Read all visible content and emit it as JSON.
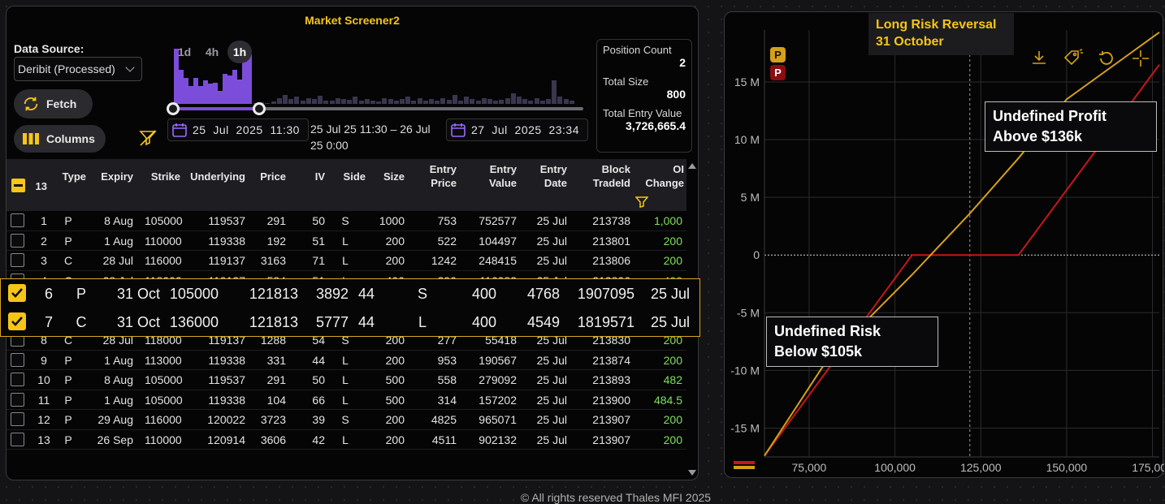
{
  "screener": {
    "title": "Market Screener2",
    "data_source_label": "Data Source:",
    "data_source_value": "Deribit (Processed)",
    "fetch_label": "Fetch",
    "columns_label": "Columns",
    "timeframes": [
      "1d",
      "4h",
      "1h"
    ],
    "active_timeframe": "1h",
    "date_from": "25  Jul  2025  11:30",
    "date_to": "27  Jul  2025  23:34",
    "range_text": "25 Jul 25 11:30 – 26 Jul 25 0:00",
    "histogram_selected": [
      0.95,
      0.58,
      0.45,
      0.3,
      0.44,
      0.3,
      0.4,
      0.35,
      0.36,
      0.22,
      0.52,
      0.48,
      0.58,
      0.42,
      0.72,
      0.85
    ],
    "histogram_rest": [
      0.02,
      0.03,
      0.02,
      0.04,
      0.1,
      0.15,
      0.08,
      0.12,
      0.06,
      0.1,
      0.08,
      0.14,
      0.06,
      0.05,
      0.1,
      0.09,
      0.07,
      0.12,
      0.05,
      0.08,
      0.06,
      0.04,
      0.1,
      0.08,
      0.05,
      0.08,
      0.12,
      0.06,
      0.1,
      0.05,
      0.08,
      0.06,
      0.1,
      0.07,
      0.15,
      0.06,
      0.12,
      0.08,
      0.06,
      0.1,
      0.08,
      0.05,
      0.07,
      0.1,
      0.18,
      0.12,
      0.08,
      0.06,
      0.1,
      0.05,
      0.08,
      0.4,
      0.12,
      0.08,
      0.06
    ],
    "stats": {
      "position_count_label": "Position Count",
      "position_count": "2",
      "total_size_label": "Total Size",
      "total_size": "800",
      "total_entry_value_label": "Total Entry Value",
      "total_entry_value": "3,726,665.4"
    },
    "selected_count": "13",
    "headers": {
      "type": "Type",
      "expiry": "Expiry",
      "strike": "Strike",
      "underlying": "Underlying",
      "price": "Price",
      "iv": "IV",
      "side": "Side",
      "size": "Size",
      "entry_price": [
        "Entry",
        "Price"
      ],
      "entry_value": [
        "Entry",
        "Value"
      ],
      "entry_date": [
        "Entry",
        "Date"
      ],
      "block": [
        "Block",
        "TradeId"
      ],
      "oi": [
        "OI",
        "Change"
      ]
    },
    "rows": [
      {
        "n": "1",
        "type": "P",
        "expiry": "8 Aug",
        "strike": "105000",
        "und": "119537",
        "price": "291",
        "iv": "50",
        "side": "S",
        "size": "1000",
        "ep": "753",
        "ev": "752577",
        "ed": "25 Jul",
        "block": "213738",
        "oi": "1,000",
        "checked": false
      },
      {
        "n": "2",
        "type": "P",
        "expiry": "1 Aug",
        "strike": "110000",
        "und": "119338",
        "price": "192",
        "iv": "51",
        "side": "L",
        "size": "200",
        "ep": "522",
        "ev": "104497",
        "ed": "25 Jul",
        "block": "213801",
        "oi": "200",
        "checked": false
      },
      {
        "n": "3",
        "type": "C",
        "expiry": "28 Jul",
        "strike": "116000",
        "und": "119137",
        "price": "3163",
        "iv": "71",
        "side": "L",
        "size": "200",
        "ep": "1242",
        "ev": "248415",
        "ed": "25 Jul",
        "block": "213806",
        "oi": "200",
        "checked": false
      },
      {
        "n": "4",
        "type": "C",
        "expiry": "28 Jul",
        "strike": "118000",
        "und": "119137",
        "price": "584",
        "iv": "51",
        "side": "L",
        "size": "400",
        "ep": "290",
        "ev": "116082",
        "ed": "25 Jul",
        "block": "213806",
        "oi": "400",
        "checked": false
      },
      {
        "n": "6",
        "type": "P",
        "expiry": "31 Oct",
        "strike": "105000",
        "und": "121813",
        "price": "3892",
        "iv": "44",
        "side": "S",
        "size": "400",
        "ep": "4768",
        "ev": "1907095",
        "ed": "25 Jul",
        "block": "213827",
        "oi": "400",
        "checked": true
      },
      {
        "n": "7",
        "type": "C",
        "expiry": "31 Oct",
        "strike": "136000",
        "und": "121813",
        "price": "5777",
        "iv": "44",
        "side": "L",
        "size": "400",
        "ep": "4549",
        "ev": "1819571",
        "ed": "25 Jul",
        "block": "213827",
        "oi": "400",
        "checked": true
      },
      {
        "n": "8",
        "type": "C",
        "expiry": "28 Jul",
        "strike": "118000",
        "und": "119137",
        "price": "1288",
        "iv": "54",
        "side": "S",
        "size": "200",
        "ep": "277",
        "ev": "55418",
        "ed": "25 Jul",
        "block": "213830",
        "oi": "200",
        "checked": false
      },
      {
        "n": "9",
        "type": "P",
        "expiry": "1 Aug",
        "strike": "113000",
        "und": "119338",
        "price": "331",
        "iv": "44",
        "side": "L",
        "size": "200",
        "ep": "953",
        "ev": "190567",
        "ed": "25 Jul",
        "block": "213874",
        "oi": "200",
        "checked": false
      },
      {
        "n": "10",
        "type": "P",
        "expiry": "8 Aug",
        "strike": "105000",
        "und": "119537",
        "price": "291",
        "iv": "50",
        "side": "L",
        "size": "500",
        "ep": "558",
        "ev": "279092",
        "ed": "25 Jul",
        "block": "213893",
        "oi": "482",
        "checked": false
      },
      {
        "n": "11",
        "type": "P",
        "expiry": "1 Aug",
        "strike": "105000",
        "und": "119338",
        "price": "104",
        "iv": "66",
        "side": "L",
        "size": "500",
        "ep": "314",
        "ev": "157202",
        "ed": "25 Jul",
        "block": "213900",
        "oi": "484.5",
        "checked": false
      },
      {
        "n": "12",
        "type": "P",
        "expiry": "29 Aug",
        "strike": "116000",
        "und": "120022",
        "price": "3723",
        "iv": "39",
        "side": "S",
        "size": "200",
        "ep": "4825",
        "ev": "965071",
        "ed": "25 Jul",
        "block": "213907",
        "oi": "200",
        "checked": false
      },
      {
        "n": "13",
        "type": "P",
        "expiry": "26 Sep",
        "strike": "110000",
        "und": "120914",
        "price": "3606",
        "iv": "42",
        "side": "L",
        "size": "200",
        "ep": "4511",
        "ev": "902132",
        "ed": "25 Jul",
        "block": "213907",
        "oi": "200",
        "checked": false
      }
    ],
    "highlighted": [
      {
        "n": "6",
        "type": "P",
        "expiry": "31 Oct",
        "strike": "105000",
        "und": "121813",
        "price": "3892",
        "iv": "44",
        "side": "S",
        "size": "400",
        "ep": "4768",
        "ev": "1907095",
        "ed": "25 Jul"
      },
      {
        "n": "7",
        "type": "C",
        "expiry": "31 Oct",
        "strike": "136000",
        "und": "121813",
        "price": "5777",
        "iv": "44",
        "side": "L",
        "size": "400",
        "ep": "4549",
        "ev": "1819571",
        "ed": "25 Jul"
      }
    ]
  },
  "payoff": {
    "title_line1": "Long Risk Reversal",
    "title_line2": "31 October",
    "annot_profit_1": "Undefined Profit",
    "annot_profit_2": "Above $136k",
    "annot_risk_1": "Undefined Risk",
    "annot_risk_2": "Below $105k",
    "legend_tags": [
      "P",
      "P"
    ],
    "colors": {
      "yellow": "#d4a017",
      "red": "#c8151b",
      "accent": "#f5c518",
      "purple": "#7c4ddb",
      "green": "#7ee05a"
    }
  },
  "chart_data": {
    "type": "line",
    "xlabel": "",
    "ylabel": "",
    "x_ticks": [
      "75,000",
      "100,000",
      "125,000",
      "150,000",
      "175,000"
    ],
    "y_ticks": [
      "15 M",
      "10 M",
      "5 M",
      "0",
      "-5 M",
      "-10 M",
      "-15 M"
    ],
    "xlim": [
      62000,
      177000
    ],
    "ylim": [
      -17500,
      19500
    ],
    "y_unit": "thousands",
    "series": [
      {
        "color": "#c8151b",
        "x": [
          62000,
          105000,
          136000,
          177000
        ],
        "y": [
          -17400,
          0,
          0,
          16500
        ]
      },
      {
        "color": "#d4a017",
        "x": [
          62000,
          80000,
          105000,
          121813,
          136000,
          150000,
          177000
        ],
        "y": [
          -17400,
          -9200,
          -1700,
          3600,
          8400,
          13500,
          19300
        ]
      }
    ],
    "spot_line_x": 121813
  },
  "footer": "© All rights reserved Thales MFI 2025"
}
